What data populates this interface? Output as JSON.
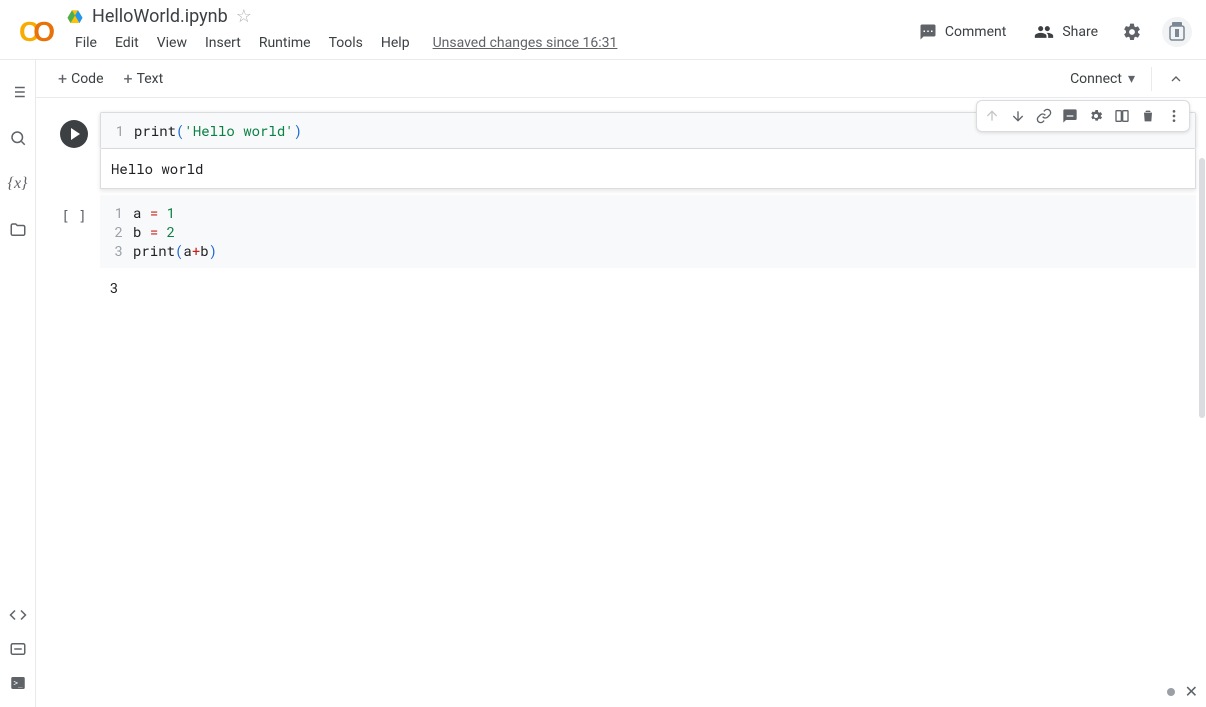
{
  "header": {
    "filename": "HelloWorld.ipynb",
    "menu": [
      "File",
      "Edit",
      "View",
      "Insert",
      "Runtime",
      "Tools",
      "Help"
    ],
    "save_status": "Unsaved changes since 16:31",
    "comment_label": "Comment",
    "share_label": "Share"
  },
  "toolbar": {
    "add_code": "Code",
    "add_text": "Text",
    "connect": "Connect"
  },
  "cells": [
    {
      "focused": true,
      "code_html": [
        "<span class='tok-fn'>print</span><span class='tok-par'>(</span><span class='tok-str'>'Hello world'</span><span class='tok-par'>)</span>"
      ],
      "output": "Hello world"
    },
    {
      "focused": false,
      "code_html": [
        "<span class='tok-var'>a </span><span class='tok-op'>=</span><span class='tok-var'> </span><span class='tok-num'>1</span>",
        "<span class='tok-var'>b </span><span class='tok-op'>=</span><span class='tok-var'> </span><span class='tok-num'>2</span>",
        "<span class='tok-fn'>print</span><span class='tok-par'>(</span><span class='tok-var'>a</span><span class='tok-op'>+</span><span class='tok-var'>b</span><span class='tok-par'>)</span>"
      ],
      "output": "3"
    }
  ],
  "cell_actions": [
    "up",
    "down",
    "link",
    "comment",
    "settings",
    "mirror",
    "delete",
    "more"
  ]
}
